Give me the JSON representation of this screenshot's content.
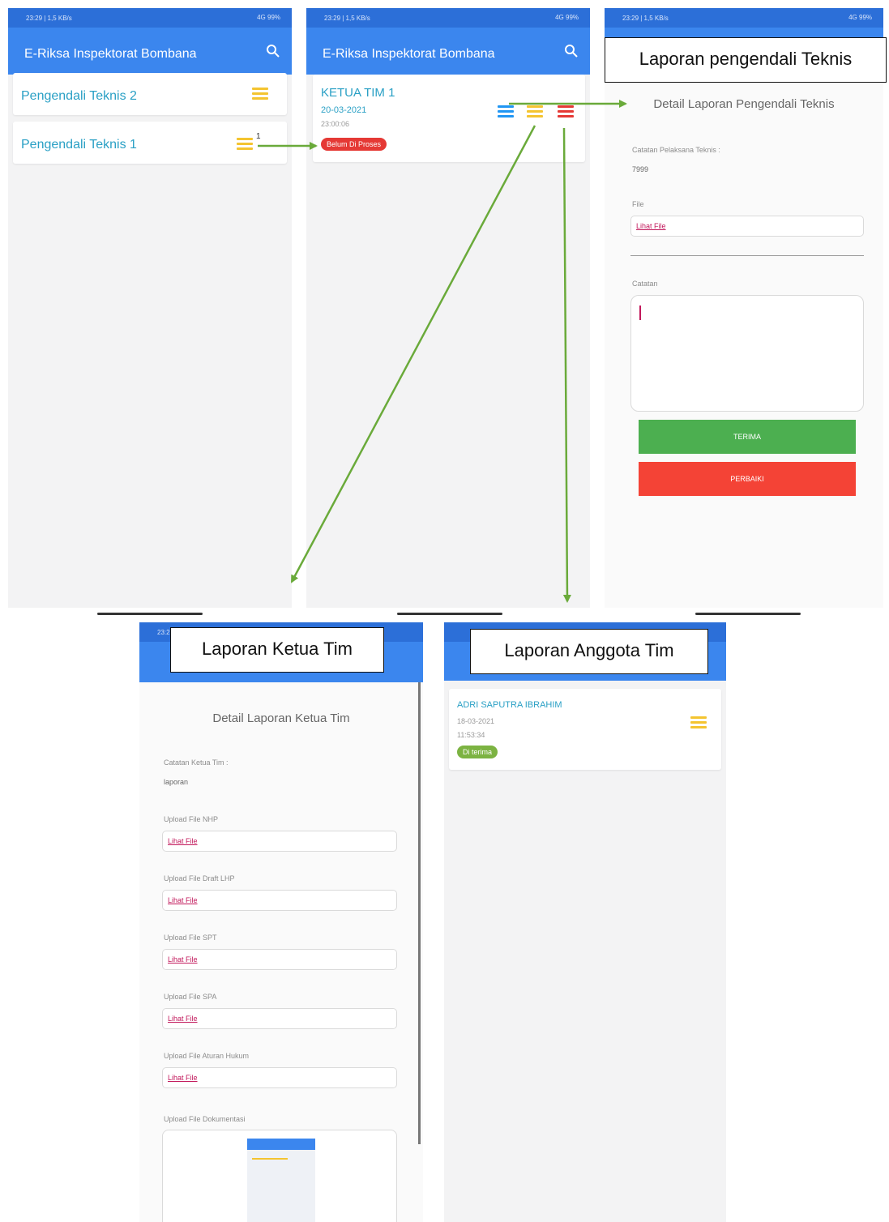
{
  "status_bar": {
    "time": "23:29 | 1,5 KB/s",
    "icons": "4G 99%"
  },
  "app_title": "E-Riksa Inspektorat Bombana",
  "colors": {
    "appbar": "#3b86ee",
    "accept": "#4caf50",
    "repair": "#f44336",
    "status_red": "#e53935",
    "status_green": "#7cb342",
    "arrow": "#6aaa3a"
  },
  "screen1": {
    "items": [
      {
        "label": "Pengendali Teknis 2"
      },
      {
        "label": "Pengendali Teknis 1",
        "badge": "1"
      }
    ]
  },
  "screen2": {
    "card": {
      "title": "KETUA TIM 1",
      "date": "20-03-2021",
      "time": "23:00:06",
      "status": "Belum Di Proses"
    }
  },
  "screen3": {
    "callout": "Laporan pengendali Teknis",
    "detail_title": "Detail Laporan Pengendali Teknis",
    "note_label": "Catatan Pelaksana Teknis :",
    "note_value": "7999",
    "file_label": "File",
    "file_link": "Lihat File",
    "catatan_label": "Catatan",
    "accept_button": "TERIMA",
    "repair_button": "PERBAIKI"
  },
  "screen4": {
    "callout": "Laporan Ketua Tim",
    "detail_title": "Detail Laporan Ketua Tim",
    "note_label": "Catatan Ketua Tim :",
    "note_value": "laporan",
    "files": [
      {
        "label": "Upload File NHP",
        "link": "Lihat File"
      },
      {
        "label": "Upload File Draft LHP",
        "link": "Lihat File"
      },
      {
        "label": "Upload File SPT",
        "link": "Lihat File"
      },
      {
        "label": "Upload File SPA",
        "link": "Lihat File"
      },
      {
        "label": "Upload File Aturan Hukum",
        "link": "Lihat File"
      }
    ],
    "doc_label": "Upload File Dokumentasi"
  },
  "screen5": {
    "callout": "Laporan Anggota Tim",
    "card": {
      "name": "ADRI SAPUTRA IBRAHIM",
      "date": "18-03-2021",
      "time": "11:53:34",
      "status": "Di terima"
    }
  }
}
